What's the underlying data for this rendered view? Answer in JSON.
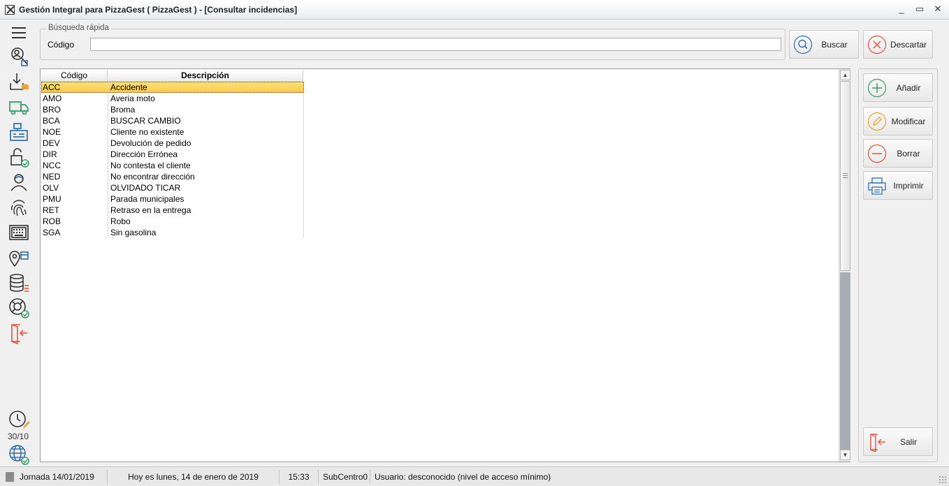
{
  "window": {
    "title": "Gestión Integral para PizzaGest ( PizzaGest ) - [Consultar incidencias]",
    "controls": {
      "minimize": "_",
      "restore": "▭",
      "close": "✕"
    }
  },
  "sidebar": {
    "icons": [
      "menu-icon",
      "search-user-icon",
      "download-box-icon",
      "delivery-truck-icon",
      "cash-register-icon",
      "unlock-check-icon",
      "user-icon",
      "fingerprint-icon",
      "keyboard-icon",
      "map-pin-store-icon",
      "database-list-icon",
      "lifebuoy-check-icon",
      "exit-door-icon",
      "clock-edit-icon",
      "globe-check-icon"
    ],
    "clock_label": "30/10"
  },
  "quick_search": {
    "legend": "Búsqueda rápida",
    "code_label": "Código",
    "code_value": "",
    "search_button": "Buscar",
    "discard_button": "Descartar"
  },
  "grid": {
    "columns": [
      "Código",
      "Descripción"
    ],
    "rows": [
      {
        "code": "ACC",
        "desc": "Accidente"
      },
      {
        "code": "AMO",
        "desc": "Averia moto"
      },
      {
        "code": "BRO",
        "desc": "Broma"
      },
      {
        "code": "BCA",
        "desc": "BUSCAR CAMBIO"
      },
      {
        "code": "NOE",
        "desc": "Cliente no existente"
      },
      {
        "code": "DEV",
        "desc": "Devolución de pedido"
      },
      {
        "code": "DIR",
        "desc": "Dirección Errónea"
      },
      {
        "code": "NCC",
        "desc": "No contesta el cliente"
      },
      {
        "code": "NED",
        "desc": "No encontrar dirección"
      },
      {
        "code": "OLV",
        "desc": "OLVIDADO TICAR"
      },
      {
        "code": "PMU",
        "desc": "Parada municipales"
      },
      {
        "code": "RET",
        "desc": "Retraso en la entrega"
      },
      {
        "code": "ROB",
        "desc": "Robo"
      },
      {
        "code": "SGA",
        "desc": "Sin gasolina"
      }
    ],
    "selected_index": 0
  },
  "actions": {
    "add": "Añadir",
    "modify": "Modificar",
    "delete": "Borrar",
    "print": "Imprimir",
    "exit": "Salir"
  },
  "status": {
    "jornada": "Jornada 14/01/2019",
    "today": "Hoy es lunes, 14 de enero de 2019",
    "time": "15:33",
    "subcentro": "SubCentro0",
    "usuario": "Usuario: desconocido (nivel de acceso mínimo)"
  },
  "colors": {
    "accent_green": "#3c9a6a",
    "accent_red": "#e0533d",
    "accent_orange": "#e8a23c",
    "icon_blue": "#2f6fa8",
    "selection_yellow": "#f9c64a"
  }
}
